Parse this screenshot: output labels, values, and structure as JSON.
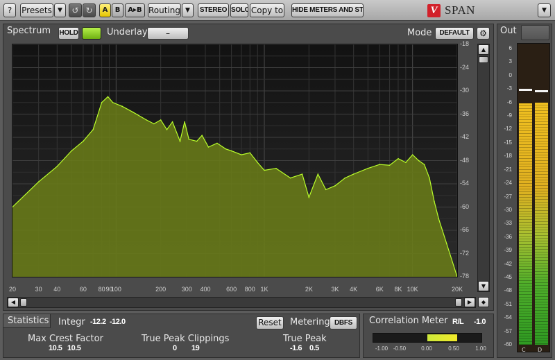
{
  "toolbar": {
    "help_label": "?",
    "presets_label": "Presets",
    "ab_a_label": "A",
    "ab_b_label": "B",
    "ab_copy_label": "A▸B",
    "routing_label": "Routing",
    "stereo_label": "STEREO",
    "solo_label": "SOLO",
    "copy_to_label": "Copy to",
    "hide_meters_label": "HIDE METERS AND STATS",
    "logo_text": "SPAN",
    "logo_mark": "V"
  },
  "spectrum": {
    "title": "Spectrum",
    "hold_label": "HOLD",
    "underlay_label": "Underlay",
    "underlay_value": "–",
    "mode_label": "Mode",
    "mode_value": "DEFAULT",
    "y_ticks": [
      "-18",
      "-24",
      "-30",
      "-36",
      "-42",
      "-48",
      "-54",
      "-60",
      "-66",
      "-72",
      "-78"
    ],
    "x_ticks": [
      "20",
      "30",
      "40",
      "60",
      "80",
      "90",
      "100",
      "200",
      "300",
      "400",
      "600",
      "800",
      "1K",
      "2K",
      "3K",
      "4K",
      "6K",
      "8K",
      "10K",
      "20K"
    ],
    "fill_color": "#6b7e17",
    "line_color": "#b9ff2a"
  },
  "chart_data": {
    "type": "area",
    "title": "",
    "xlabel": "",
    "ylabel": "",
    "x_scale": "log",
    "xlim": [
      20,
      20000
    ],
    "ylim": [
      -78,
      -18
    ],
    "x": [
      20,
      30,
      40,
      50,
      60,
      70,
      80,
      88,
      95,
      110,
      130,
      160,
      180,
      200,
      220,
      240,
      270,
      290,
      310,
      350,
      380,
      420,
      480,
      550,
      600,
      700,
      800,
      900,
      1000,
      1200,
      1500,
      1800,
      2000,
      2300,
      2600,
      3000,
      3500,
      4000,
      5000,
      6000,
      7000,
      8000,
      9000,
      10000,
      11000,
      12000,
      13000,
      14000,
      15000,
      17000,
      20000
    ],
    "y": [
      -60,
      -53.5,
      -49.5,
      -45.5,
      -43,
      -40,
      -33,
      -31.5,
      -33,
      -34,
      -35.5,
      -37.5,
      -38.5,
      -37.5,
      -40,
      -38,
      -43,
      -38,
      -42.5,
      -43,
      -41.5,
      -44.5,
      -43.5,
      -45,
      -45.5,
      -46.5,
      -46,
      -48.5,
      -50.5,
      -50,
      -52.5,
      -51.5,
      -57.5,
      -51.5,
      -55.5,
      -54.5,
      -52.5,
      -51.5,
      -50,
      -49,
      -49.2,
      -47.5,
      -48.5,
      -46.5,
      -48,
      -49,
      -52.5,
      -58.5,
      -63,
      -69.5,
      -78
    ]
  },
  "output_meter": {
    "title": "Out",
    "scale": [
      "6",
      "3",
      "0",
      "-3",
      "-6",
      "-9",
      "-12",
      "-15",
      "-18",
      "-21",
      "-24",
      "-27",
      "-30",
      "-33",
      "-36",
      "-39",
      "-42",
      "-45",
      "-48",
      "-51",
      "-54",
      "-57",
      "-60"
    ],
    "channels": [
      "C",
      "D"
    ],
    "levels_db": [
      -6.2,
      -6.0
    ],
    "peak_hold_db": [
      -3.0,
      -3.3
    ]
  },
  "statistics": {
    "title": "Statistics",
    "integr_label": "Integr",
    "integr_values": [
      "-12.2",
      "-12.0"
    ],
    "reset_label": "Reset",
    "metering_label": "Metering",
    "metering_value": "DBFS",
    "max_crest_label": "Max Crest Factor",
    "max_crest_values": [
      "10.5",
      "10.5"
    ],
    "true_peak_clip_label": "True Peak Clippings",
    "true_peak_clip_values": [
      "0",
      "19"
    ],
    "true_peak_label": "True Peak",
    "true_peak_values": [
      "-1.6",
      "0.5"
    ]
  },
  "correlation": {
    "title": "Correlation Meter",
    "rl_label": "R/L",
    "rl_value": "-1.0",
    "scale": [
      "-1.00",
      "-0.50",
      "0.00",
      "0.50",
      "1.00"
    ],
    "value": 0.55
  }
}
